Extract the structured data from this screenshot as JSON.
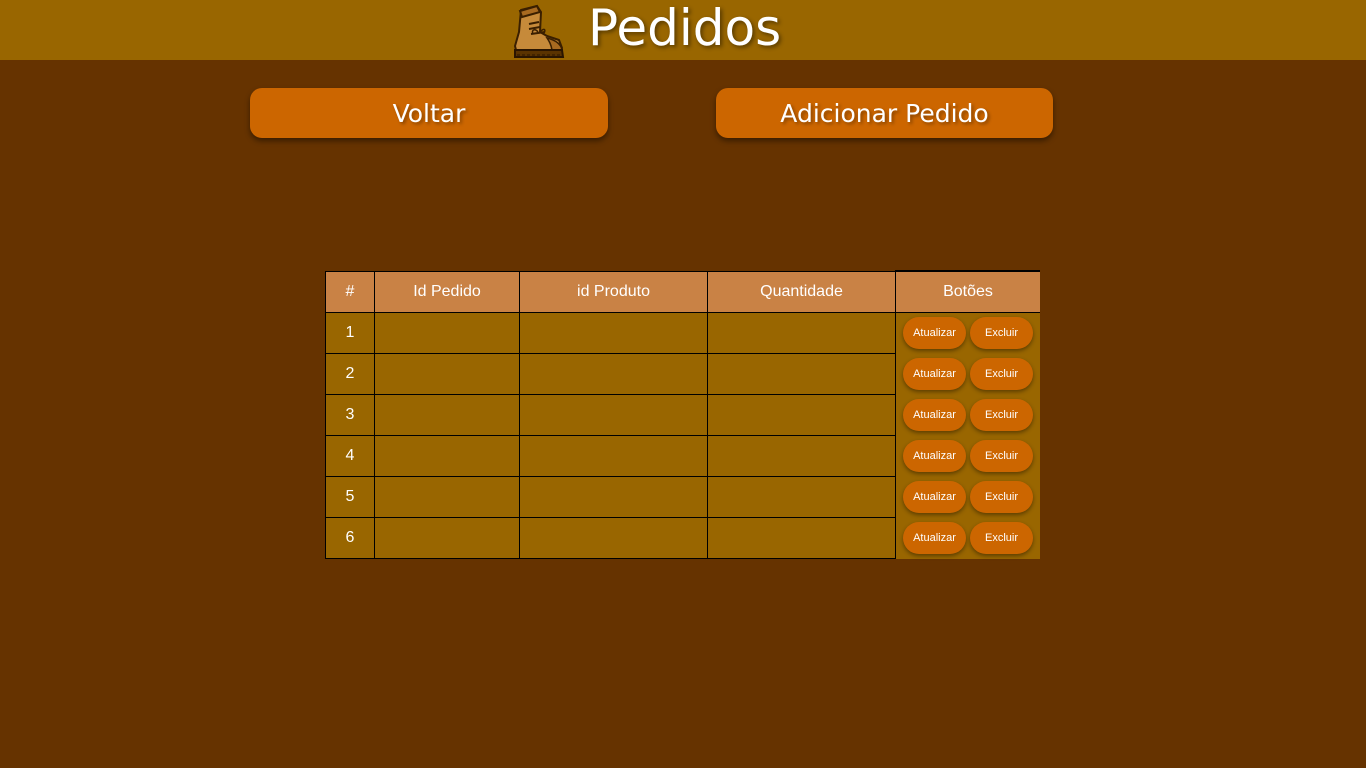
{
  "header": {
    "title": "Pedidos",
    "logo_icon": "boot-icon"
  },
  "nav": {
    "back_label": "Voltar",
    "add_label": "Adicionar Pedido"
  },
  "table": {
    "columns": [
      "#",
      "Id Pedido",
      "id Produto",
      "Quantidade",
      "Botões"
    ],
    "rows": [
      {
        "num": "1",
        "id_pedido": "",
        "id_produto": "",
        "quantidade": "",
        "update_label": "Atualizar",
        "delete_label": "Excluir"
      },
      {
        "num": "2",
        "id_pedido": "",
        "id_produto": "",
        "quantidade": "",
        "update_label": "Atualizar",
        "delete_label": "Excluir"
      },
      {
        "num": "3",
        "id_pedido": "",
        "id_produto": "",
        "quantidade": "",
        "update_label": "Atualizar",
        "delete_label": "Excluir"
      },
      {
        "num": "4",
        "id_pedido": "",
        "id_produto": "",
        "quantidade": "",
        "update_label": "Atualizar",
        "delete_label": "Excluir"
      },
      {
        "num": "5",
        "id_pedido": "",
        "id_produto": "",
        "quantidade": "",
        "update_label": "Atualizar",
        "delete_label": "Excluir"
      },
      {
        "num": "6",
        "id_pedido": "",
        "id_produto": "",
        "quantidade": "",
        "update_label": "Atualizar",
        "delete_label": "Excluir"
      }
    ]
  },
  "colors": {
    "page_bg": "#663300",
    "header_bg": "#996600",
    "button": "#cc6600",
    "table_header": "#c98245",
    "table_cell": "#996600"
  }
}
